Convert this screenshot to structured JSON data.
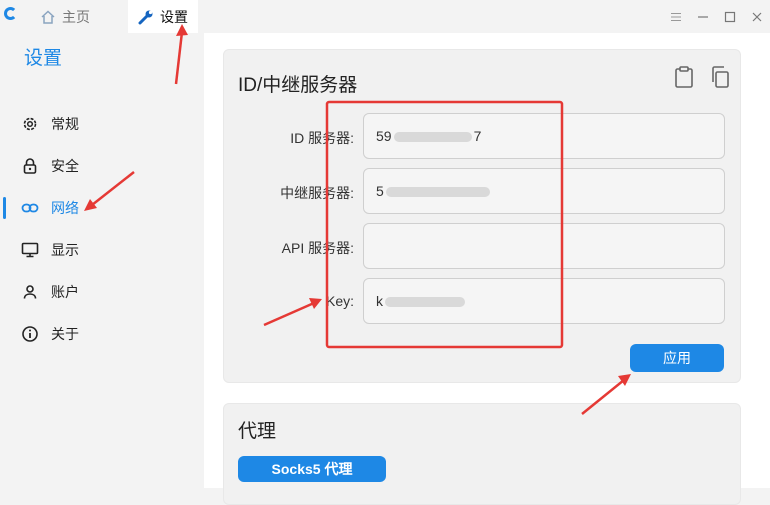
{
  "titlebar": {
    "tabs": [
      {
        "label": "主页",
        "icon": "home-icon"
      },
      {
        "label": "设置",
        "icon": "wrench-icon"
      }
    ],
    "window_buttons": [
      "menu-icon",
      "minimize-icon",
      "maximize-icon",
      "close-icon"
    ]
  },
  "sidebar": {
    "title": "设置",
    "items": [
      {
        "label": "常规",
        "icon": "gear-icon"
      },
      {
        "label": "安全",
        "icon": "lock-icon"
      },
      {
        "label": "网络",
        "icon": "link-icon",
        "active": true
      },
      {
        "label": "显示",
        "icon": "monitor-icon"
      },
      {
        "label": "账户",
        "icon": "user-icon"
      },
      {
        "label": "关于",
        "icon": "info-icon"
      }
    ]
  },
  "server_card": {
    "title": "ID/中继服务器",
    "fields": [
      {
        "label": "ID 服务器:",
        "value_prefix": "59",
        "value_suffix": "7"
      },
      {
        "label": "中继服务器:",
        "value_prefix": "5",
        "value_suffix": ""
      },
      {
        "label": "API 服务器:",
        "value_prefix": "",
        "value_suffix": ""
      },
      {
        "label": "Key:",
        "value_prefix": "k",
        "value_suffix": ""
      }
    ],
    "apply_label": "应用"
  },
  "proxy_card": {
    "title": "代理",
    "socks_label": "Socks5 代理"
  },
  "colors": {
    "accent": "#1e88e5",
    "annotation": "#e53935"
  }
}
